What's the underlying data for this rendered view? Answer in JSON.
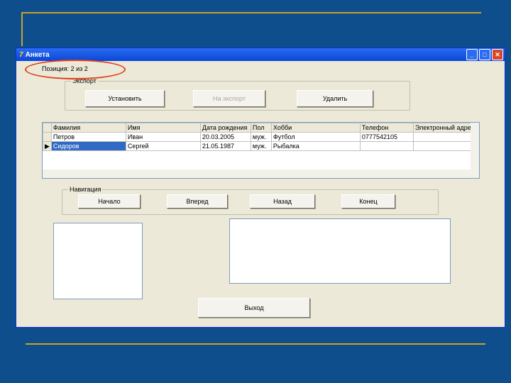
{
  "window": {
    "title": "Анкета",
    "minimize": "_",
    "maximize": "□",
    "close": "✕"
  },
  "position_label": "Позиция: 2 из 2",
  "records_group": {
    "label": "Экспорт",
    "buttons": [
      "Установить",
      "На экспорт",
      "Удалить"
    ],
    "disabled": [
      false,
      true,
      false
    ]
  },
  "table": {
    "columns": [
      "Фамилия",
      "Имя",
      "Дата рождения",
      "Пол",
      "Хобби",
      "Телефон",
      "Электронный адрес"
    ],
    "rows": [
      [
        "Петров",
        "Иван",
        "20.03.2005",
        "муж.",
        "Футбол",
        "0777542105",
        ""
      ],
      [
        "Сидоров",
        "Сергей",
        "21.05.1987",
        "муж.",
        "Рыбалка",
        "",
        ""
      ]
    ],
    "selected_row": 1
  },
  "nav_group": {
    "label": "Навигация",
    "buttons": [
      "Начало",
      "Вперед",
      "Назад",
      "Конец"
    ]
  },
  "exit_button": "Выход"
}
